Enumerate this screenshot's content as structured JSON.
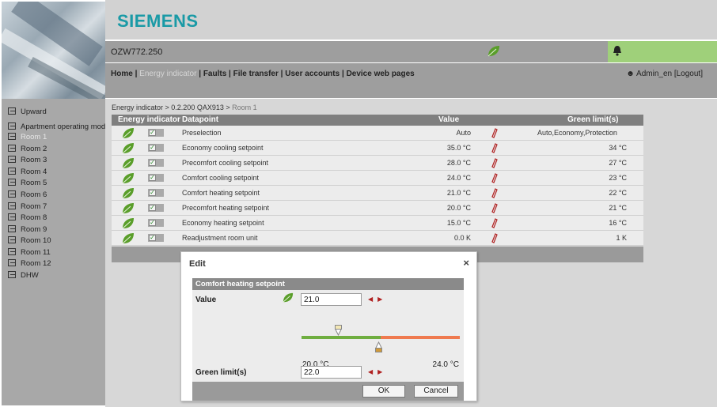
{
  "brand": {
    "name": "SIEMENS",
    "color": "#1a9aa6"
  },
  "device": {
    "name": "OZW772.250"
  },
  "nav": {
    "home": "Home",
    "energy": "Energy indicator",
    "faults": "Faults",
    "file_transfer": "File transfer",
    "user_accounts": "User accounts",
    "device_web_pages": "Device web pages",
    "separator": "|"
  },
  "user": {
    "label": "Admin_en",
    "logout": "[Logout]"
  },
  "sidebar": {
    "items": [
      {
        "label": "Upward"
      },
      {
        "label": "Apartment operating mode"
      },
      {
        "label": "Room 1",
        "active": true
      },
      {
        "label": "Room 2"
      },
      {
        "label": "Room 3"
      },
      {
        "label": "Room 4"
      },
      {
        "label": "Room 5"
      },
      {
        "label": "Room 6"
      },
      {
        "label": "Room 7"
      },
      {
        "label": "Room 8"
      },
      {
        "label": "Room 9"
      },
      {
        "label": "Room 10"
      },
      {
        "label": "Room 11"
      },
      {
        "label": "Room 12"
      },
      {
        "label": "DHW"
      }
    ]
  },
  "breadcrumb": {
    "path": "Energy indicator > 0.2.200 QAX913 > ",
    "current": "Room 1"
  },
  "table": {
    "headers": {
      "energy": "Energy indicator",
      "datapoint": "Datapoint",
      "value": "Value",
      "green": "Green limit(s)"
    },
    "rows": [
      {
        "datapoint": "Preselection",
        "value": "Auto",
        "green": "Auto,Economy,Protection"
      },
      {
        "datapoint": "Economy cooling setpoint",
        "value": "35.0 °C",
        "green": "34 °C"
      },
      {
        "datapoint": "Precomfort cooling setpoint",
        "value": "28.0 °C",
        "green": "27 °C"
      },
      {
        "datapoint": "Comfort cooling setpoint",
        "value": "24.0 °C",
        "green": "23 °C"
      },
      {
        "datapoint": "Comfort heating setpoint",
        "value": "21.0 °C",
        "green": "22 °C"
      },
      {
        "datapoint": "Precomfort heating setpoint",
        "value": "20.0 °C",
        "green": "21 °C"
      },
      {
        "datapoint": "Economy heating setpoint",
        "value": "15.0 °C",
        "green": "16 °C"
      },
      {
        "datapoint": "Readjustment room unit",
        "value": "0.0 K",
        "green": "1 K"
      }
    ]
  },
  "dialog": {
    "title": "Edit",
    "close": "×",
    "section": "Comfort heating setpoint",
    "value_label": "Value",
    "value": "21.0",
    "min_label": "20.0 °C",
    "max_label": "24.0 °C",
    "green_label": "Green limit(s)",
    "green_value": "22.0",
    "ok": "OK",
    "cancel": "Cancel"
  },
  "icons": {
    "leaf": "leaf-icon",
    "bell": "bell-icon",
    "pencil": "pencil-icon",
    "check": "checkbox-icon",
    "user": "user-icon",
    "close": "close-icon"
  },
  "colors": {
    "leaf": "#5a9e2a",
    "alarm": "#9fd07a",
    "slider_green": "#6fae40",
    "slider_orange": "#ef7a4f"
  }
}
